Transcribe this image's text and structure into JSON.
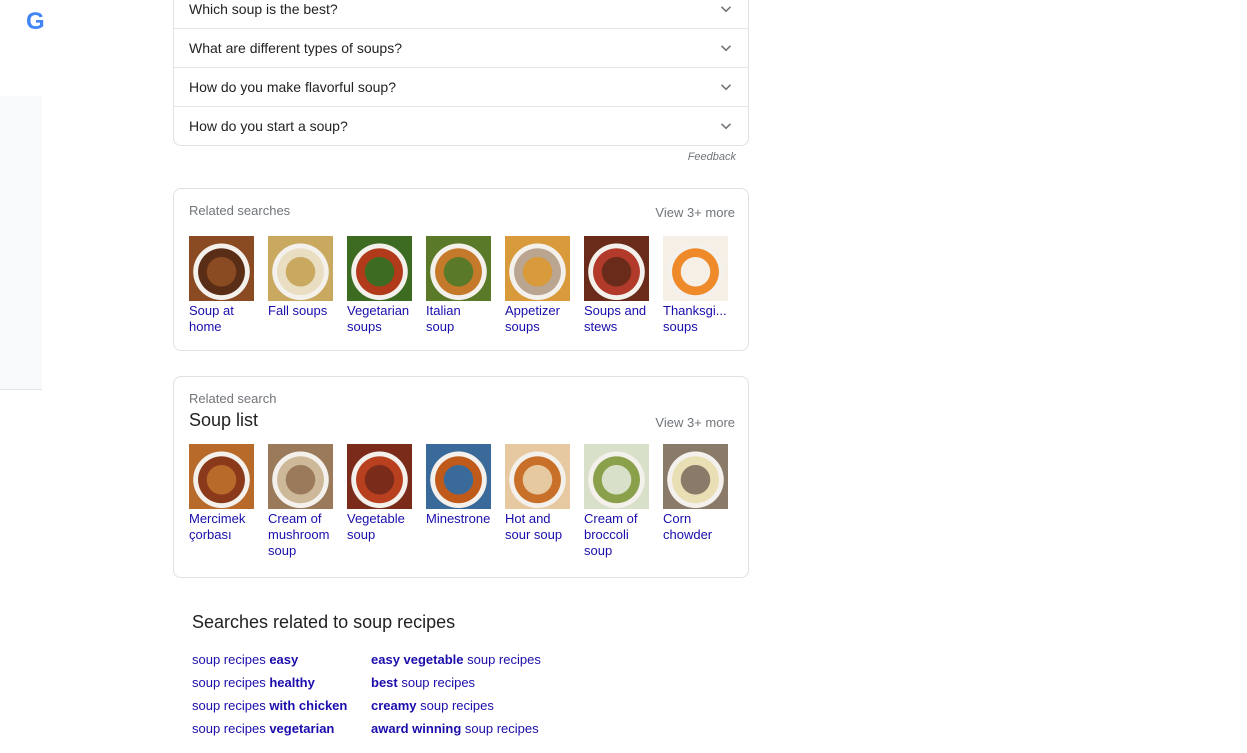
{
  "left_rail": {
    "logo_letter": "G"
  },
  "paa": {
    "questions": [
      "Which soup is the best?",
      "What are different types of soups?",
      "How do you make flavorful soup?",
      "How do you start a soup?"
    ],
    "feedback": "Feedback"
  },
  "related_searches": {
    "title": "Related searches",
    "view_more": "View 3+ more",
    "items": [
      {
        "label": "Soup at home",
        "colors": [
          "#5a2e16",
          "#8a4a22"
        ]
      },
      {
        "label": "Fall soups",
        "colors": [
          "#e9ddc2",
          "#c9a860"
        ]
      },
      {
        "label": "Vegetarian soups",
        "colors": [
          "#b03a1a",
          "#3d6b22"
        ]
      },
      {
        "label": "Italian soup",
        "colors": [
          "#c47a2a",
          "#5a7a2a"
        ]
      },
      {
        "label": "Appetizer soups",
        "colors": [
          "#b9a590",
          "#d89a3a"
        ]
      },
      {
        "label": "Soups and stews",
        "colors": [
          "#b23a2a",
          "#6a2b1a"
        ]
      },
      {
        "label": "Thanksgi... soups",
        "colors": [
          "#ef8a2a",
          "#f5efe5"
        ]
      }
    ]
  },
  "soup_list": {
    "small_title": "Related search",
    "title": "Soup list",
    "view_more": "View 3+ more",
    "items": [
      {
        "label": "Mercimek çorbası",
        "colors": [
          "#8a3a1a",
          "#b86a2a"
        ]
      },
      {
        "label": "Cream of mushroom soup",
        "colors": [
          "#cdb89a",
          "#9a7a5a"
        ]
      },
      {
        "label": "Vegetable soup",
        "colors": [
          "#b8401f",
          "#7a2b1a"
        ]
      },
      {
        "label": "Minestrone",
        "colors": [
          "#c05a1a",
          "#3a6a9a"
        ]
      },
      {
        "label": "Hot and sour soup",
        "colors": [
          "#c8702a",
          "#e6c9a0"
        ]
      },
      {
        "label": "Cream of broccoli soup",
        "colors": [
          "#8aa04a",
          "#d9e0c9"
        ]
      },
      {
        "label": "Corn chowder",
        "colors": [
          "#e9dfb5",
          "#8a7a6a"
        ]
      }
    ]
  },
  "searches_related": {
    "title": "Searches related to soup recipes",
    "left": [
      {
        "plain": "soup recipes ",
        "bold": "easy",
        "bold_first": false
      },
      {
        "plain": "soup recipes ",
        "bold": "healthy",
        "bold_first": false
      },
      {
        "plain": "soup recipes ",
        "bold": "with chicken",
        "bold_first": false
      },
      {
        "plain": "soup recipes ",
        "bold": "vegetarian",
        "bold_first": false
      }
    ],
    "right": [
      {
        "plain": " soup recipes",
        "bold": "easy vegetable",
        "bold_first": true
      },
      {
        "plain": " soup recipes",
        "bold": "best",
        "bold_first": true
      },
      {
        "plain": " soup recipes",
        "bold": "creamy",
        "bold_first": true
      },
      {
        "plain": " soup recipes",
        "bold": "award winning",
        "bold_first": true
      }
    ]
  }
}
